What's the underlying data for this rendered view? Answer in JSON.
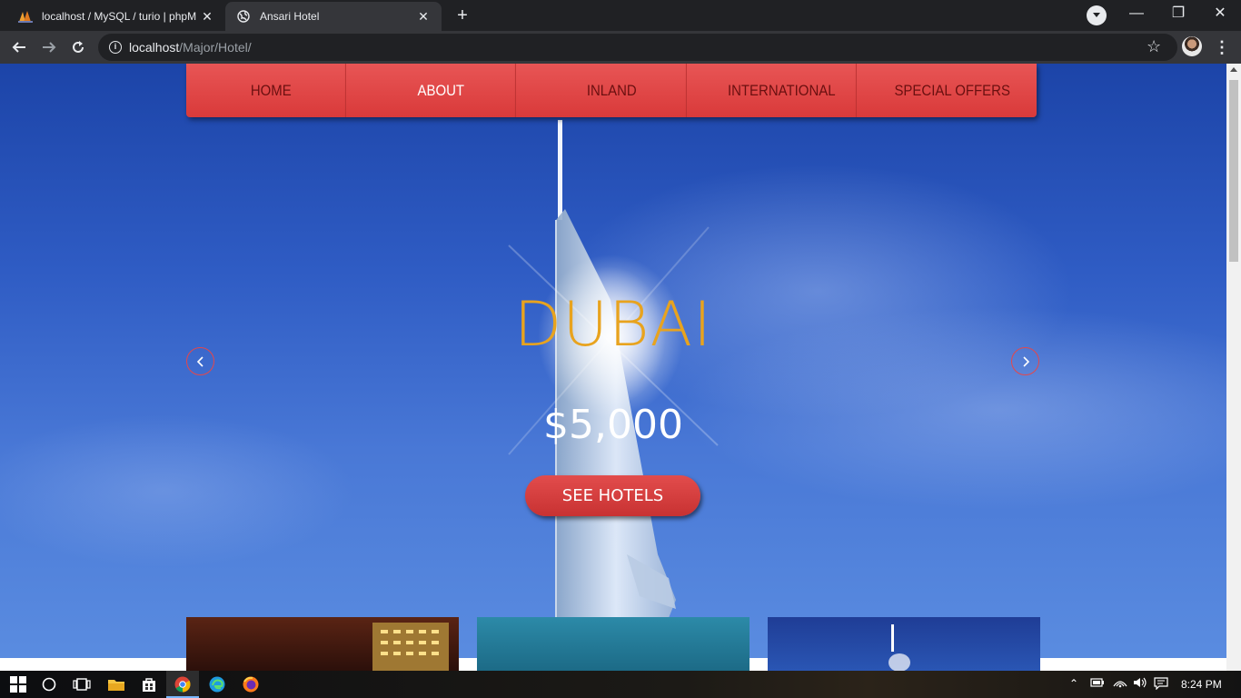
{
  "browser": {
    "tabs": [
      {
        "title": "localhost / MySQL / turio | phpM",
        "active": false,
        "icon": "phpmyadmin-icon"
      },
      {
        "title": "Ansari Hotel",
        "active": true,
        "icon": "globe-icon"
      }
    ],
    "url_host": "localhost",
    "url_path": "/Major/Hotel/"
  },
  "site": {
    "nav": [
      "HOME",
      "ABOUT",
      "INLAND",
      "INTERNATIONAL",
      "SPECIAL OFFERS"
    ],
    "active_nav": "ABOUT",
    "slide": {
      "title": "DUBAI",
      "price": "$5,000",
      "cta": "SEE HOTELS"
    }
  },
  "colors": {
    "nav_red": "#e04545",
    "title_gold": "#e8a31e",
    "sky_blue": "#2f5cc4"
  },
  "taskbar": {
    "clock": "8:24 PM"
  }
}
